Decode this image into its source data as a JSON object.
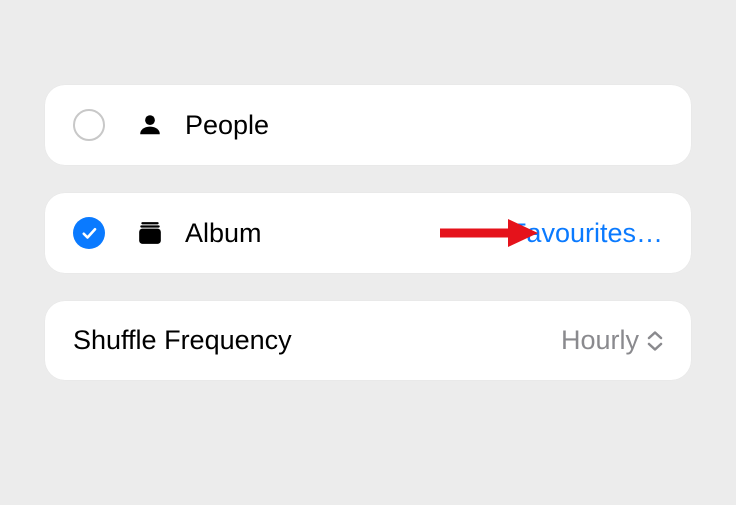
{
  "options": {
    "people": {
      "label": "People",
      "selected": false
    },
    "album": {
      "label": "Album",
      "selected": true,
      "value": "Favourites…"
    }
  },
  "shuffle": {
    "label": "Shuffle Frequency",
    "value": "Hourly"
  }
}
